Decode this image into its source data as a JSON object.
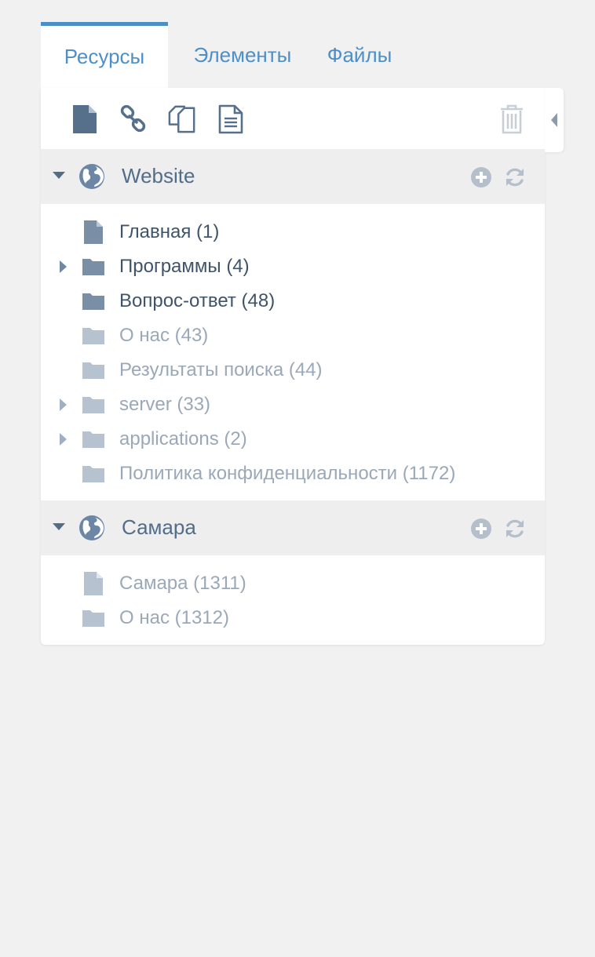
{
  "tabs": [
    {
      "label": "Ресурсы",
      "active": true
    },
    {
      "label": "Элементы",
      "active": false
    },
    {
      "label": "Файлы",
      "active": false
    }
  ],
  "toolbar": {
    "icons": [
      "new-document-icon",
      "weblink-icon",
      "symlink-icon",
      "static-resource-icon",
      "trash-icon"
    ]
  },
  "contexts": [
    {
      "title": "Website",
      "expanded": true,
      "items": [
        {
          "label": "Главная (1)",
          "type": "document",
          "published": true,
          "has_children": false
        },
        {
          "label": "Программы (4)",
          "type": "folder",
          "published": true,
          "has_children": true
        },
        {
          "label": "Вопрос-ответ (48)",
          "type": "folder",
          "published": true,
          "has_children": false
        },
        {
          "label": "О нас (43)",
          "type": "folder",
          "published": false,
          "has_children": false
        },
        {
          "label": "Результаты поиска (44)",
          "type": "folder",
          "published": false,
          "has_children": false
        },
        {
          "label": "server (33)",
          "type": "folder",
          "published": false,
          "has_children": true
        },
        {
          "label": "applications (2)",
          "type": "folder",
          "published": false,
          "has_children": true
        },
        {
          "label": "Политика конфиденциальности (1172)",
          "type": "folder",
          "published": false,
          "has_children": false
        }
      ]
    },
    {
      "title": "Самара",
      "expanded": true,
      "items": [
        {
          "label": "Самара (1311)",
          "type": "document",
          "published": false,
          "has_children": false
        },
        {
          "label": "О нас (1312)",
          "type": "folder",
          "published": false,
          "has_children": false
        }
      ]
    }
  ],
  "colors": {
    "accent": "#4b8fc6",
    "dark_text": "#3f5469",
    "light_text": "#9aa8b8",
    "header_bg": "#eeeeee",
    "page_bg": "#f1f1f1"
  }
}
